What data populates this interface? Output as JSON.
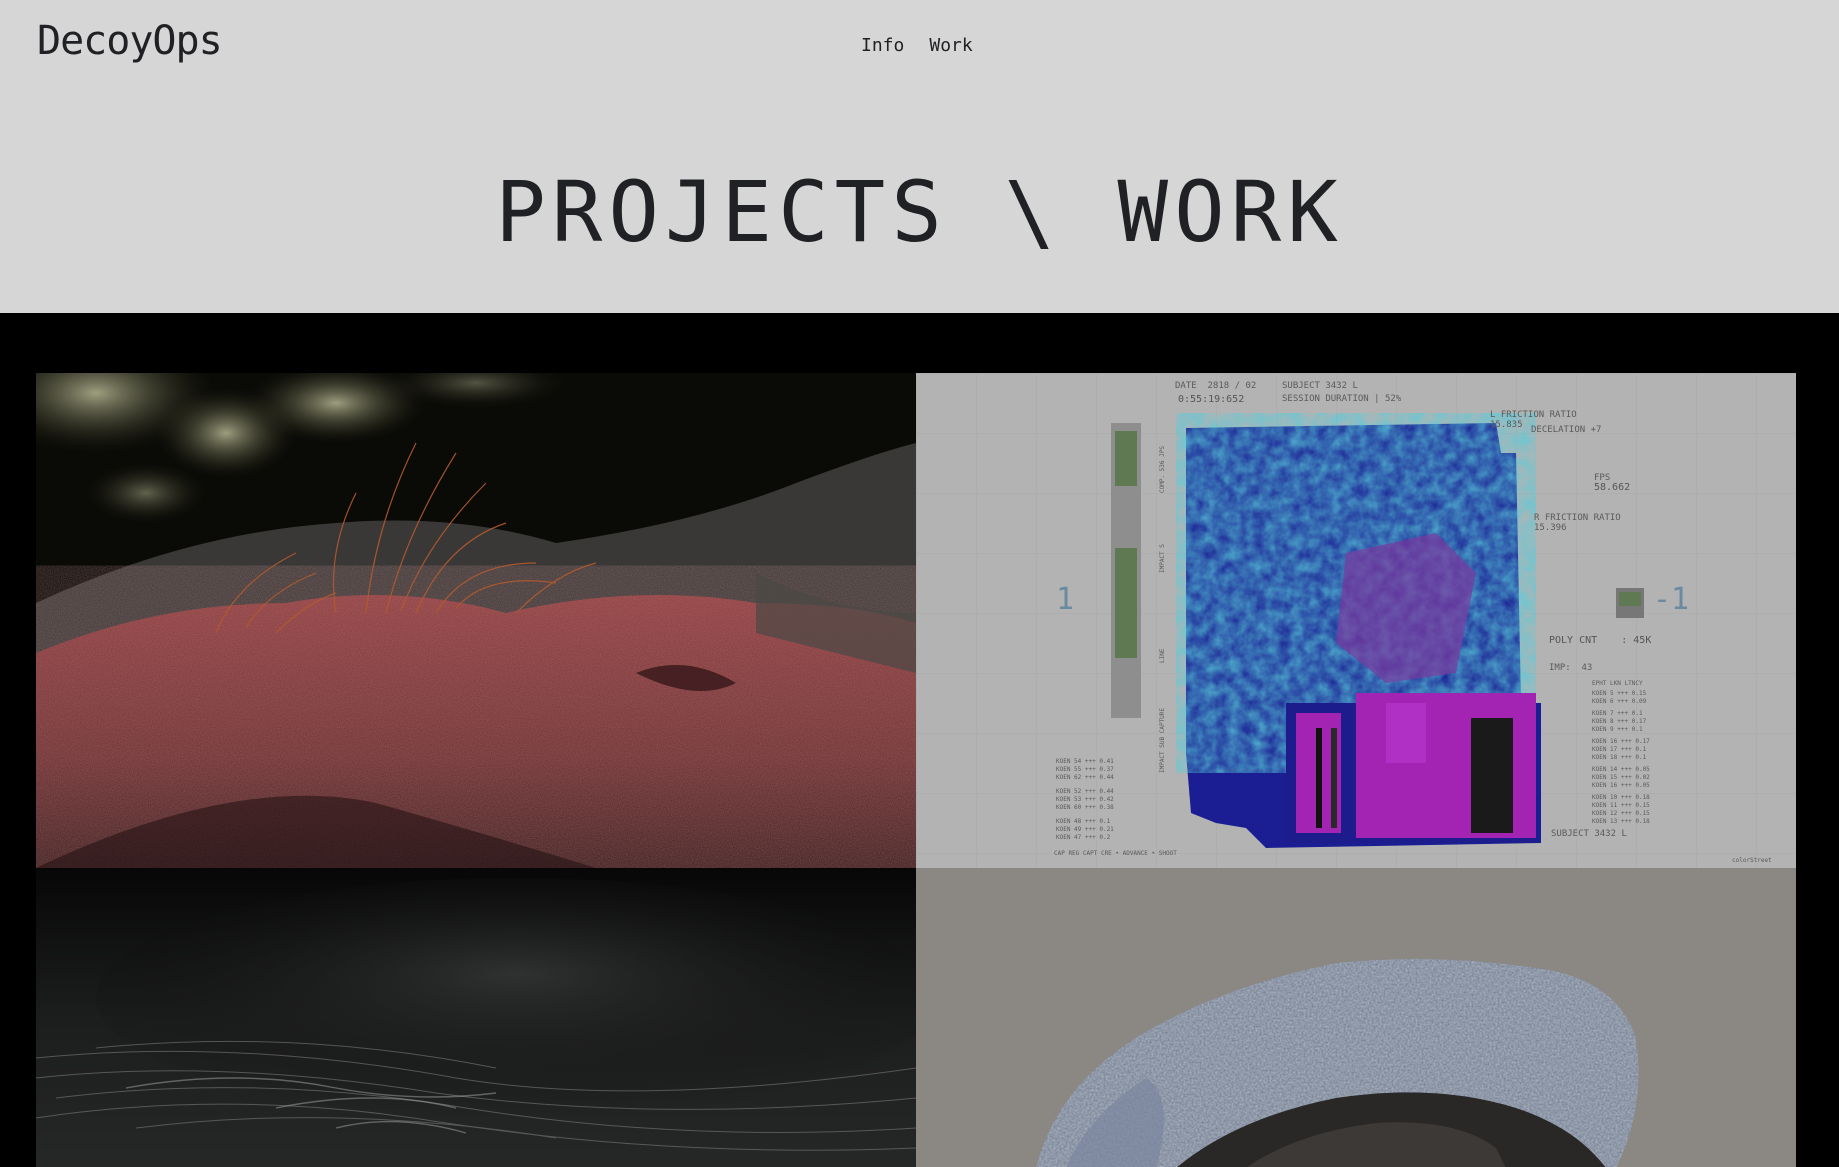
{
  "header": {
    "logo": "DecoyOps",
    "nav": [
      {
        "label": "Info"
      },
      {
        "label": "Work"
      }
    ],
    "title": "PROJECTS \\ WORK"
  },
  "tiles": [
    {
      "name": "moss-red-rock"
    },
    {
      "name": "subject-scan-hud",
      "hud": {
        "date": "DATE  2818 / 02",
        "time": "0:55:19:652",
        "subject": "SUBJECT 3432 L",
        "session": "SESSION DURATION | 52%",
        "friction_top": "L FRICTION RATIO\n15.835",
        "deceleration": "DECELATION +7",
        "fps_label": "FPS",
        "fps_value": "58.662",
        "friction_right": "R FRICTION RATIO\n15.396",
        "left_marker": "1",
        "right_marker": "-1",
        "poly_count": "POLY CNT    : 45K",
        "imp": "IMP:  43",
        "subject_footer": "SUBJECT 3432 L"
      }
    },
    {
      "name": "dark-hair-strands"
    },
    {
      "name": "frosted-rock"
    }
  ],
  "colors": {
    "header_bg": "#d6d6d6",
    "text": "#202124",
    "page_bg": "#000000"
  }
}
